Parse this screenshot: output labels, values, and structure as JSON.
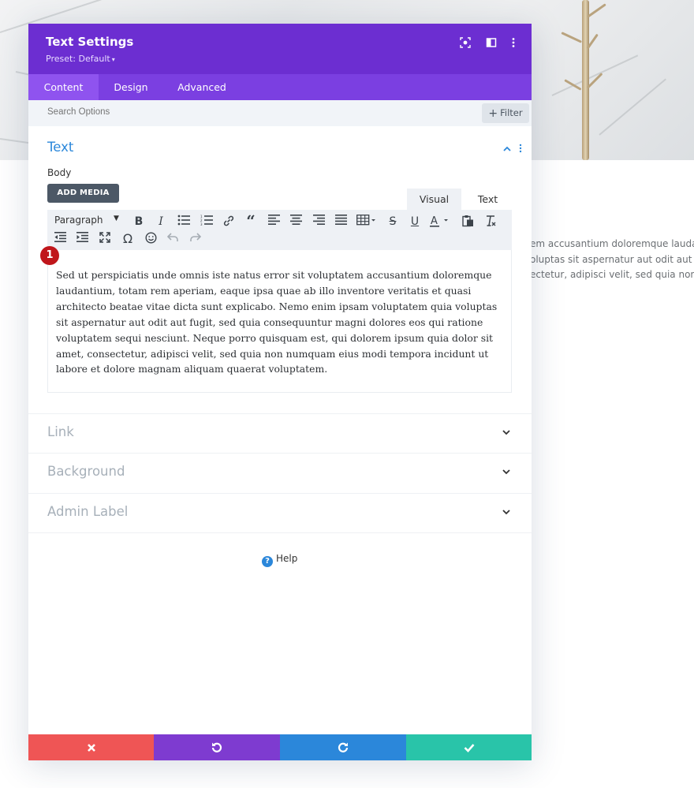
{
  "page": {
    "background_text": [
      "em accusantium doloremque laudanti",
      "oluptas sit aspernatur aut odit aut fugi",
      "ectetur, adipisci velit, sed quia non nu"
    ]
  },
  "modal": {
    "title": "Text Settings",
    "preset": "Preset: Default",
    "header_icons": [
      "focus-icon",
      "sidebar-toggle-icon",
      "more-vertical-icon"
    ],
    "tabs": [
      {
        "label": "Content",
        "active": true
      },
      {
        "label": "Design",
        "active": false
      },
      {
        "label": "Advanced",
        "active": false
      }
    ],
    "search": {
      "placeholder": "Search Options",
      "filter_label": "Filter"
    },
    "text_section": {
      "title": "Text",
      "body_label": "Body",
      "add_media_label": "ADD MEDIA",
      "editor_tabs": {
        "visual": "Visual",
        "text": "Text"
      },
      "format_select": "Paragraph",
      "badge": "1",
      "content": "Sed ut perspiciatis unde omnis iste natus error sit voluptatem accusantium doloremque laudantium, totam rem aperiam, eaque ipsa quae ab illo inventore veritatis et quasi architecto beatae vitae dicta sunt explicabo. Nemo enim ipsam voluptatem quia voluptas sit aspernatur aut odit aut fugit, sed quia consequuntur magni dolores eos qui ratione voluptatem sequi nesciunt. Neque porro quisquam est, qui dolorem ipsum quia dolor sit amet, consectetur, adipisci velit, sed quia non numquam eius modi tempora incidunt ut labore et dolore magnam aliquam quaerat voluptatem."
    },
    "sections": [
      {
        "label": "Link"
      },
      {
        "label": "Background"
      },
      {
        "label": "Admin Label"
      }
    ],
    "help_label": "Help",
    "footer": {
      "cancel_color": "#ef5555",
      "undo_color": "#7e3bd0",
      "redo_color": "#2b87da",
      "save_color": "#29c4a9"
    },
    "colors": {
      "header": "#6c2ed1",
      "tabs": "#7b3fe1",
      "active_tab": "#8f53ef",
      "accent": "#2b87da",
      "badge": "#c0161b"
    }
  }
}
